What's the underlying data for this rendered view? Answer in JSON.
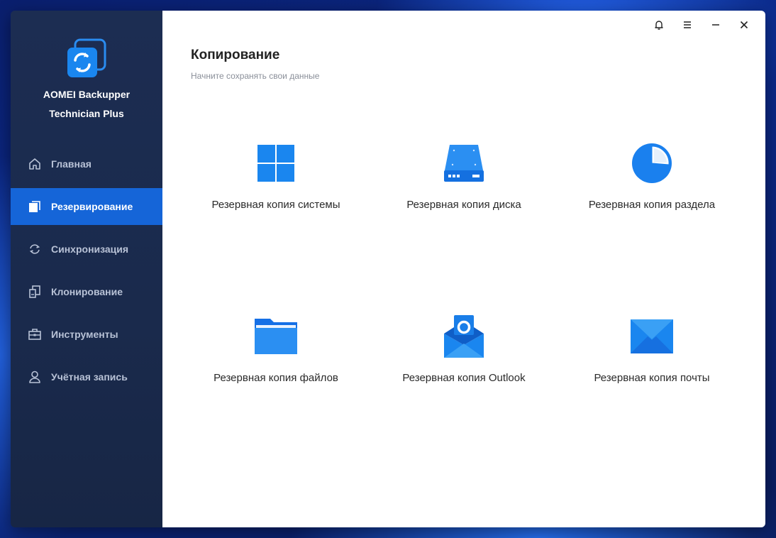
{
  "sidebar": {
    "brand_line1": "AOMEI Backupper",
    "brand_line2": "Technician Plus",
    "items": [
      {
        "label": "Главная",
        "icon": "home-icon"
      },
      {
        "label": "Резервирование",
        "icon": "backup-icon"
      },
      {
        "label": "Синхронизация",
        "icon": "sync-icon"
      },
      {
        "label": "Клонирование",
        "icon": "clone-icon"
      },
      {
        "label": "Инструменты",
        "icon": "toolbox-icon"
      },
      {
        "label": "Учётная запись",
        "icon": "user-icon"
      }
    ],
    "active_index": 1
  },
  "window_controls": [
    "bell-icon",
    "menu-icon",
    "minimize-icon",
    "close-icon"
  ],
  "main": {
    "title": "Копирование",
    "subtitle": "Начните сохранять свои данные",
    "tiles": [
      {
        "label": "Резервная копия системы",
        "icon": "windows-icon"
      },
      {
        "label": "Резервная копия диска",
        "icon": "disk-icon"
      },
      {
        "label": "Резервная копия раздела",
        "icon": "partition-pie-icon"
      },
      {
        "label": "Резервная копия файлов",
        "icon": "folder-icon"
      },
      {
        "label": "Резервная копия Outlook",
        "icon": "outlook-icon"
      },
      {
        "label": "Резервная копия почты",
        "icon": "mail-envelope-icon"
      }
    ]
  },
  "colors": {
    "accent": "#1565d8",
    "sidebar_bg": "#1c2d52",
    "icon_blue": "#1a7cf0"
  }
}
